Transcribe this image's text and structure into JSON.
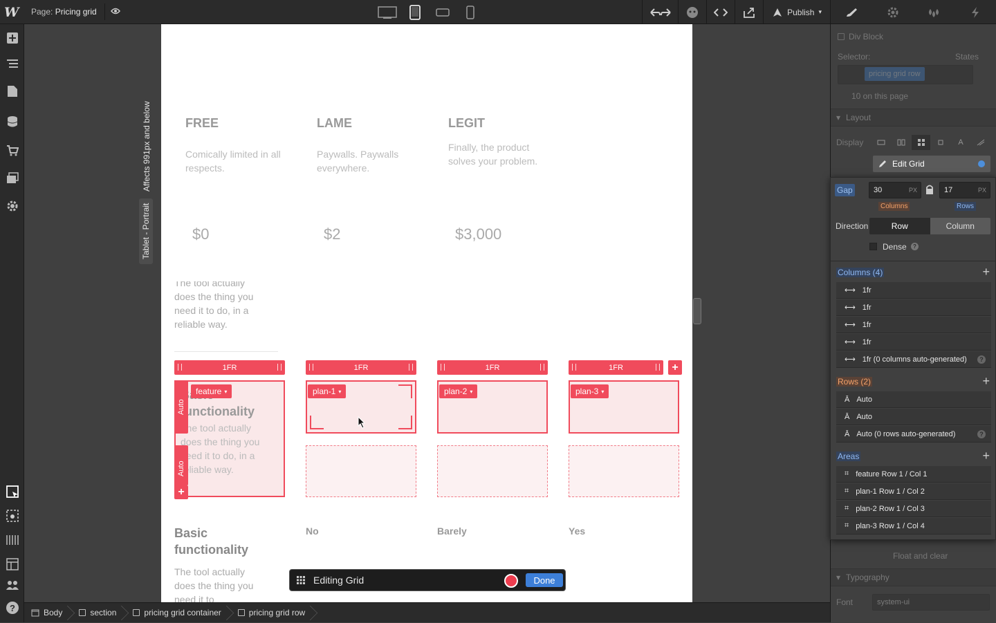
{
  "topbar": {
    "page_prefix": "Page:",
    "page_name": "Pricing grid",
    "publish_label": "Publish"
  },
  "artboard": {
    "breakpoint_tag": "Tablet - Portrait",
    "breakpoint_note": "Affects 991px and below",
    "plans": [
      {
        "title": "FREE",
        "desc": "Comically limited in all respects.",
        "price": "$0"
      },
      {
        "title": "LAME",
        "desc": "Paywalls. Paywalls everywhere.",
        "price": "$2"
      },
      {
        "title": "LEGIT",
        "desc": "Finally, the product solves your problem.",
        "price": "$3,000"
      }
    ],
    "overflow_text": "The tool actually does the thing you need it to do, in a reliable way.",
    "grid": {
      "col_labels": [
        "1FR",
        "1FR",
        "1FR",
        "1FR"
      ],
      "row_labels": [
        "Auto",
        "Auto"
      ],
      "areas": [
        "feature",
        "plan-1",
        "plan-2",
        "plan-3"
      ],
      "feature_heading": "Basic functionality",
      "feature_text": "The tool actually does the thing you need it to do, in a reliable way."
    },
    "below": {
      "heading": "Basic functionality",
      "text": "The tool actually does the thing you need it to",
      "values": [
        "No",
        "Barely",
        "Yes"
      ]
    },
    "edit_bar": {
      "title": "Editing Grid",
      "done_label": "Done"
    }
  },
  "breadcrumbs": [
    "Body",
    "section",
    "pricing grid container",
    "pricing grid row"
  ],
  "style_panel": {
    "element_type": "Div Block",
    "selector_label": "Selector:",
    "states_label": "States",
    "selector_tag": "pricing grid row",
    "on_page": "10 on this page",
    "layout_title": "Layout",
    "display_label": "Display",
    "edit_grid_label": "Edit Grid",
    "float_label": "Float and clear",
    "typography_title": "Typography",
    "font_label": "Font",
    "font_value": "system-ui"
  },
  "grid_panel": {
    "gap_label": "Gap",
    "gap_columns": "30",
    "gap_rows": "17",
    "unit": "PX",
    "columns_tag": "Columns",
    "rows_tag": "Rows",
    "direction_label": "Direction",
    "direction_row": "Row",
    "direction_column": "Column",
    "dense_label": "Dense",
    "columns_title": "Columns (4)",
    "columns": [
      "1fr",
      "1fr",
      "1fr",
      "1fr",
      "1fr (0 columns auto-generated)"
    ],
    "rows_title": "Rows (2)",
    "rows": [
      "Auto",
      "Auto",
      "Auto (0 rows auto-generated)"
    ],
    "areas_title": "Areas",
    "areas": [
      "feature Row 1 / Col 1",
      "plan-1 Row 1 / Col 2",
      "plan-2 Row 1 / Col 3",
      "plan-3 Row 1 / Col 4"
    ]
  },
  "colors": {
    "grid_accent": "#f04b5c",
    "done_blue": "#3d7fd8",
    "selector_blue": "#3b7fd1"
  }
}
